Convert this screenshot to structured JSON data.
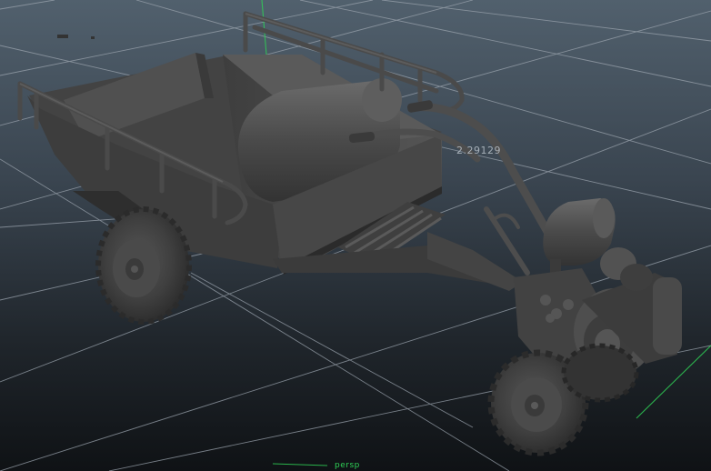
{
  "viewport": {
    "camera_name": "persp",
    "readout_value": "2.29129",
    "background_top": "#51606d",
    "background_bottom": "#0f1215",
    "grid_color": "#9aa3ad",
    "axis_color": "#2fcf56",
    "model_color": "#4b4b4b"
  },
  "scene": {
    "model": "motor-tricycle-walking-tractor",
    "parts": [
      "trailer-bed",
      "side-railings",
      "fuel-tank",
      "wheels",
      "engine",
      "handlebars",
      "footboard"
    ]
  }
}
